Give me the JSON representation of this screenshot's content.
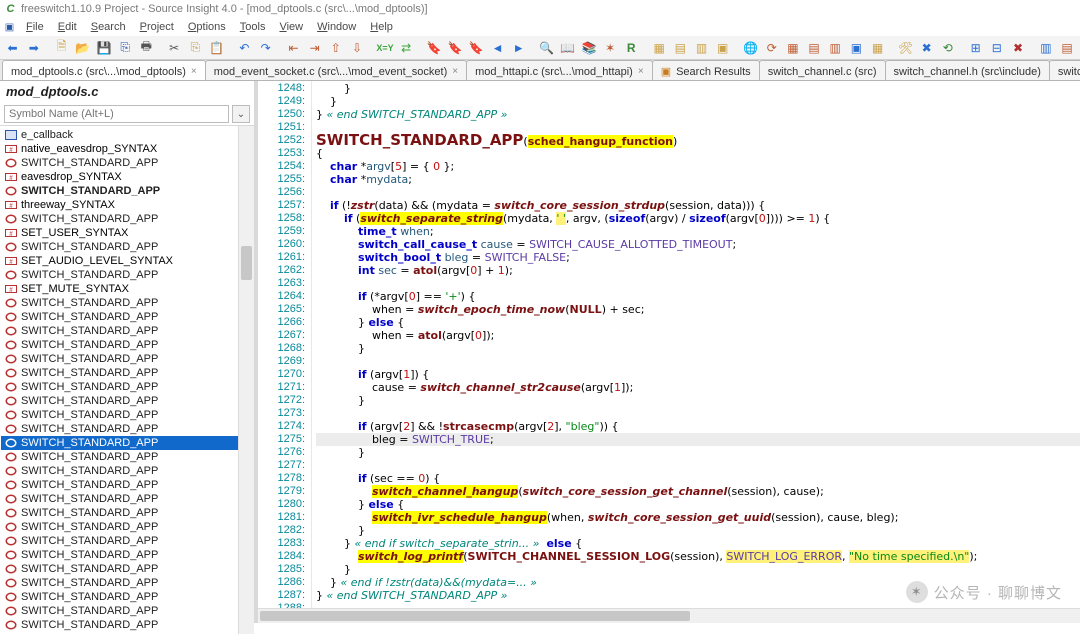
{
  "window_title": "freeswitch1.10.9 Project - Source Insight 4.0 - [mod_dptools.c (src\\...\\mod_dptools)]",
  "menus": [
    "File",
    "Edit",
    "Search",
    "Project",
    "Options",
    "Tools",
    "View",
    "Window",
    "Help"
  ],
  "tabs": [
    {
      "label": "mod_dptools.c (src\\...\\mod_dptools)",
      "active": true,
      "closable": true
    },
    {
      "label": "mod_event_socket.c (src\\...\\mod_event_socket)",
      "active": false,
      "closable": true
    },
    {
      "label": "mod_httapi.c (src\\...\\mod_httapi)",
      "active": false,
      "closable": true
    },
    {
      "label": "Search Results",
      "active": false,
      "closable": false,
      "icon": "search-results"
    },
    {
      "label": "switch_channel.c (src)",
      "active": false,
      "closable": false
    },
    {
      "label": "switch_channel.h (src\\include)",
      "active": false,
      "closable": false
    },
    {
      "label": "switch_console.h (src\\inclu",
      "active": false,
      "closable": false
    }
  ],
  "sidebar": {
    "title": "mod_dptools.c",
    "search_placeholder": "Symbol Name (Alt+L)",
    "items": [
      {
        "icon": "struct",
        "label": "e_callback"
      },
      {
        "icon": "define",
        "label": "native_eavesdrop_SYNTAX"
      },
      {
        "icon": "func",
        "label": "SWITCH_STANDARD_APP"
      },
      {
        "icon": "define",
        "label": "eavesdrop_SYNTAX"
      },
      {
        "icon": "func",
        "label": "SWITCH_STANDARD_APP",
        "bold": true
      },
      {
        "icon": "define",
        "label": "threeway_SYNTAX"
      },
      {
        "icon": "func",
        "label": "SWITCH_STANDARD_APP"
      },
      {
        "icon": "define",
        "label": "SET_USER_SYNTAX"
      },
      {
        "icon": "func",
        "label": "SWITCH_STANDARD_APP"
      },
      {
        "icon": "define",
        "label": "SET_AUDIO_LEVEL_SYNTAX"
      },
      {
        "icon": "func",
        "label": "SWITCH_STANDARD_APP"
      },
      {
        "icon": "define",
        "label": "SET_MUTE_SYNTAX"
      },
      {
        "icon": "func",
        "label": "SWITCH_STANDARD_APP"
      },
      {
        "icon": "func",
        "label": "SWITCH_STANDARD_APP"
      },
      {
        "icon": "func",
        "label": "SWITCH_STANDARD_APP"
      },
      {
        "icon": "func",
        "label": "SWITCH_STANDARD_APP"
      },
      {
        "icon": "func",
        "label": "SWITCH_STANDARD_APP"
      },
      {
        "icon": "func",
        "label": "SWITCH_STANDARD_APP"
      },
      {
        "icon": "func",
        "label": "SWITCH_STANDARD_APP"
      },
      {
        "icon": "func",
        "label": "SWITCH_STANDARD_APP"
      },
      {
        "icon": "func",
        "label": "SWITCH_STANDARD_APP"
      },
      {
        "icon": "func",
        "label": "SWITCH_STANDARD_APP"
      },
      {
        "icon": "func",
        "label": "SWITCH_STANDARD_APP",
        "selected": true
      },
      {
        "icon": "func",
        "label": "SWITCH_STANDARD_APP"
      },
      {
        "icon": "func",
        "label": "SWITCH_STANDARD_APP"
      },
      {
        "icon": "func",
        "label": "SWITCH_STANDARD_APP"
      },
      {
        "icon": "func",
        "label": "SWITCH_STANDARD_APP"
      },
      {
        "icon": "func",
        "label": "SWITCH_STANDARD_APP"
      },
      {
        "icon": "func",
        "label": "SWITCH_STANDARD_APP"
      },
      {
        "icon": "func",
        "label": "SWITCH_STANDARD_APP"
      },
      {
        "icon": "func",
        "label": "SWITCH_STANDARD_APP"
      },
      {
        "icon": "func",
        "label": "SWITCH_STANDARD_APP"
      },
      {
        "icon": "func",
        "label": "SWITCH_STANDARD_APP"
      },
      {
        "icon": "func",
        "label": "SWITCH_STANDARD_APP"
      },
      {
        "icon": "func",
        "label": "SWITCH_STANDARD_APP"
      },
      {
        "icon": "func",
        "label": "SWITCH_STANDARD_APP"
      }
    ]
  },
  "gutter_start": 1248,
  "gutter_end": 1288,
  "code_lines": [
    "        }",
    "    }",
    "} <span class='cmt-end'>« end SWITCH_STANDARD_APP »</span>",
    "",
    "<span class='big'>SWITCH_STANDARD_APP</span>(<span class='hly fn'>sched_hangup_function</span>)",
    "{",
    "    <span class='kw'>char</span> *<span class='var'>argv</span>[<span class='num'>5</span>] = { <span class='num'>0</span> };",
    "    <span class='kw'>char</span> *<span class='var'>mydata</span>;",
    "",
    "    <span class='kw'>if</span> (!<span class='fn-i'>zstr</span>(data) && (mydata = <span class='fn-i'>switch_core_session_strdup</span>(session, data))) {",
    "        <span class='kw'>if</span> (<span class='fn-i hly'>switch_separate_string</span>(mydata, <span class='str hly2'>' '</span>, argv, (<span class='kw'>sizeof</span>(argv) / <span class='kw'>sizeof</span>(argv[<span class='num'>0</span>]))) >= <span class='num'>1</span>) {",
    "            <span class='kw'>time_t</span> <span class='var'>when</span>;",
    "            <span class='kw'>switch_call_cause_t</span> <span class='var'>cause</span> = <span class='enum'>SWITCH_CAUSE_ALLOTTED_TIMEOUT</span>;",
    "            <span class='kw'>switch_bool_t</span> <span class='var'>bleg</span> = <span class='enum'>SWITCH_FALSE</span>;",
    "            <span class='kw'>int</span> <span class='var'>sec</span> = <span class='fn'>atol</span>(argv[<span class='num'>0</span>] + <span class='num'>1</span>);",
    "",
    "            <span class='kw'>if</span> (*argv[<span class='num'>0</span>] == <span class='str'>'+'</span>) {",
    "                when = <span class='fn-i'>switch_epoch_time_now</span>(<span class='mac'>NULL</span>) + sec;",
    "            } <span class='kw'>else</span> {",
    "                when = <span class='fn'>atol</span>(argv[<span class='num'>0</span>]);",
    "            }",
    "",
    "            <span class='kw'>if</span> (argv[<span class='num'>1</span>]) {",
    "                cause = <span class='fn-i'>switch_channel_str2cause</span>(argv[<span class='num'>1</span>]);",
    "            }",
    "",
    "            <span class='kw'>if</span> (argv[<span class='num'>2</span>] && !<span class='fn'>strcasecmp</span>(argv[<span class='num'>2</span>], <span class='str'>\"bleg\"</span>)) {",
    "                bleg = <span class='enum'>SWITCH_TRUE</span>;",
    "            }",
    "",
    "            <span class='kw'>if</span> (sec == <span class='num'>0</span>) {",
    "                <span class='fn-i hly'>switch_channel_hangup</span>(<span class='fn-i'>switch_core_session_get_channel</span>(session), cause);",
    "            } <span class='kw'>else</span> {",
    "                <span class='fn-i hly'>switch_ivr_schedule_hangup</span>(when, <span class='fn-i'>switch_core_session_get_uuid</span>(session), cause, bleg);",
    "            }",
    "        } <span class='cmt-end'>« end if switch_separate_strin... »</span>  <span class='kw'>else</span> {",
    "            <span class='fn-i hly'>switch_log_printf</span>(<span class='mac'>SWITCH_CHANNEL_SESSION_LOG</span>(session), <span class='enum hly2'>SWITCH_LOG_ERROR</span>, <span class='str hly2'>\"No time specified.\\n\"</span>);",
    "        }",
    "    } <span class='cmt-end'>« end if !zstr(data)&&(mydata=... »</span>",
    "} <span class='cmt-end'>« end SWITCH_STANDARD_APP »</span>",
    ""
  ],
  "highlight_line_index": 27,
  "watermark": "公众号 · 聊聊博文"
}
